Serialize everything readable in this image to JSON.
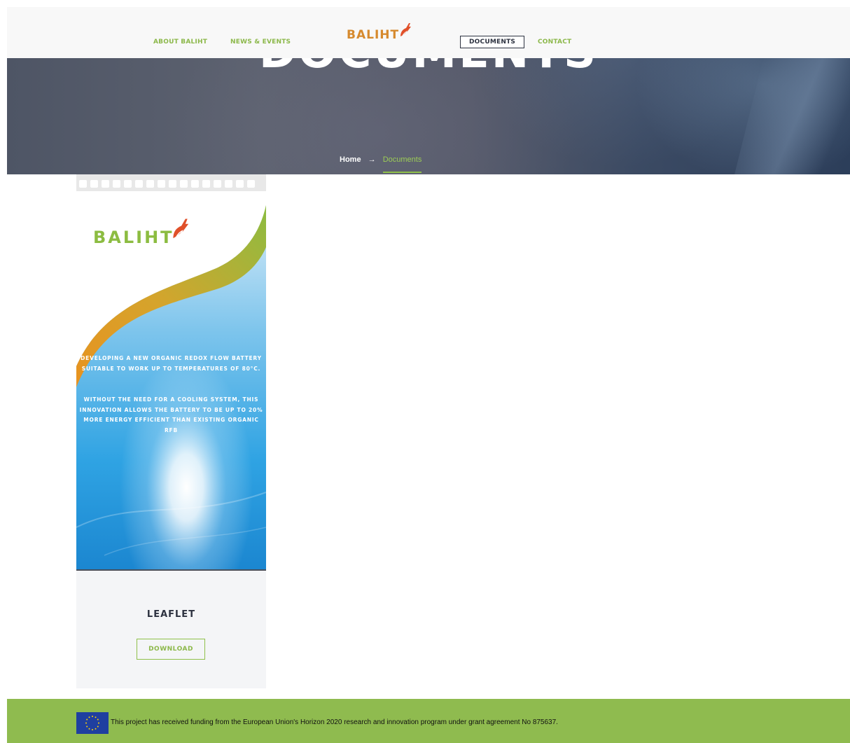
{
  "nav": {
    "items": [
      {
        "label": "ABOUT BALIHT"
      },
      {
        "label": "NEWS & EVENTS"
      },
      {
        "label": "DOCUMENTS",
        "active": true
      },
      {
        "label": "CONTACT"
      }
    ],
    "logo_text": "BALIHT"
  },
  "hero": {
    "title": "DOCUMENTS"
  },
  "breadcrumb": {
    "home": "Home",
    "separator": "→",
    "current": "Documents"
  },
  "document": {
    "leaflet_logo": "BALIHT",
    "leaflet_text_1": "DEVELOPING A NEW ORGANIC REDOX FLOW BATTERY SUITABLE TO WORK UP TO TEMPERATURES OF 80°C.",
    "leaflet_text_2": "WITHOUT THE NEED FOR A COOLING SYSTEM, THIS INNOVATION ALLOWS THE BATTERY TO BE UP TO 20% MORE ENERGY EFFICIENT THAN EXISTING ORGANIC RFB",
    "title": "LEAFLET",
    "download_label": "DOWNLOAD"
  },
  "footer": {
    "funding_text": "This project has received funding from the European Union's Horizon 2020 research and innovation program under grant agreement No 875637."
  },
  "colors": {
    "accent_green": "#8fbb4f",
    "logo_orange": "#d68a2e",
    "logo_red": "#e0502a",
    "dark": "#2d3240",
    "eu_blue": "#1f3fa0"
  }
}
